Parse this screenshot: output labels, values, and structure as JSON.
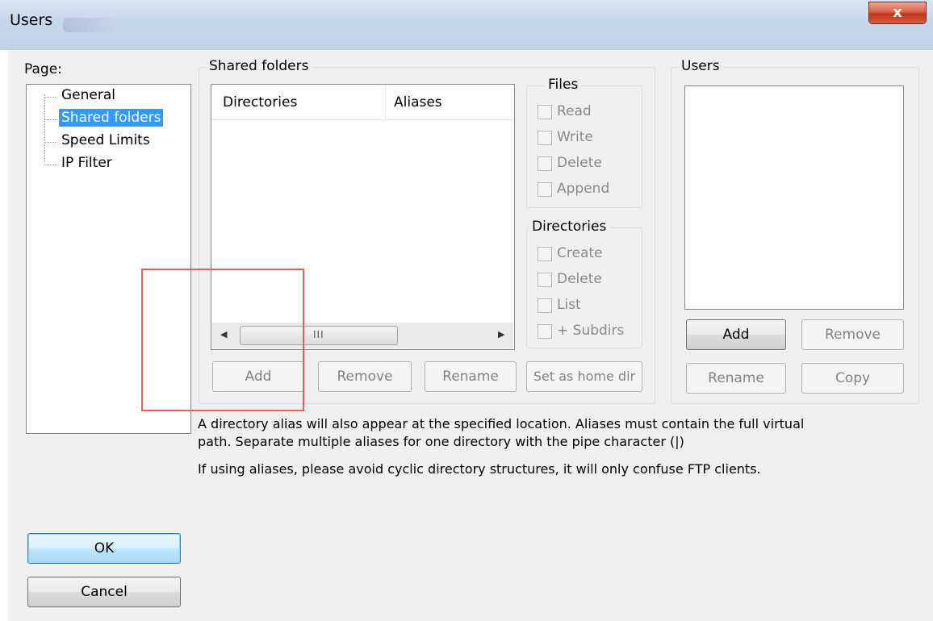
{
  "window": {
    "title": "Users",
    "close_glyph": "x"
  },
  "page_label": "Page:",
  "tree": {
    "items": [
      {
        "label": "General",
        "selected": false
      },
      {
        "label": "Shared folders",
        "selected": true
      },
      {
        "label": "Speed Limits",
        "selected": false
      },
      {
        "label": "IP Filter",
        "selected": false
      }
    ]
  },
  "shared_folders": {
    "caption": "Shared folders",
    "columns": [
      "Directories",
      "Aliases"
    ],
    "scroll_grip": "III",
    "buttons": {
      "add": "Add",
      "remove": "Remove",
      "rename": "Rename",
      "set_home": "Set as home dir"
    }
  },
  "files_group": {
    "caption": "Files",
    "options": [
      "Read",
      "Write",
      "Delete",
      "Append"
    ]
  },
  "directories_group": {
    "caption": "Directories",
    "options": [
      "Create",
      "Delete",
      "List",
      "+ Subdirs"
    ]
  },
  "users_group": {
    "caption": "Users",
    "buttons": {
      "add": "Add",
      "remove": "Remove",
      "rename": "Rename",
      "copy": "Copy"
    }
  },
  "info": {
    "line1": "A directory alias will also appear at the specified location. Aliases must contain the full virtual",
    "line2": "path. Separate multiple aliases for one directory with the pipe character (|)",
    "line3": "If using aliases, please avoid cyclic directory structures, it will only confuse FTP clients."
  },
  "dialog_buttons": {
    "ok": "OK",
    "cancel": "Cancel"
  },
  "colors": {
    "selection": "#3399ff",
    "annotation_box": "#e06060"
  }
}
